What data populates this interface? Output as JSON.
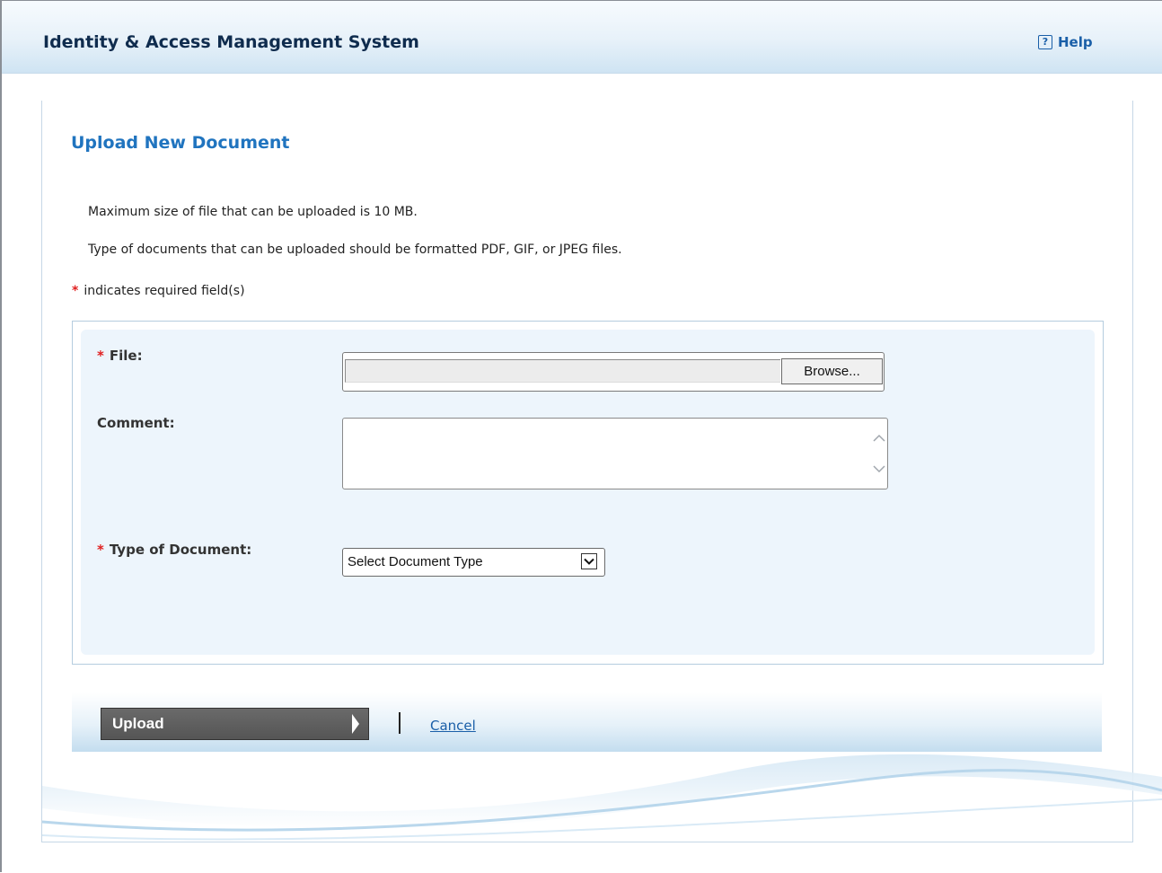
{
  "header": {
    "app_title": "Identity & Access Management System",
    "help_label": "Help",
    "help_icon_glyph": "?"
  },
  "page": {
    "title": "Upload New Document",
    "info_lines": [
      "Maximum size of file that can be uploaded is 10 MB.",
      "Type of documents that can be uploaded should be formatted PDF, GIF, or JPEG files."
    ],
    "required_note": "indicates required field(s)",
    "required_marker": "*"
  },
  "form": {
    "file_label": "File:",
    "file_value": "",
    "browse_label": "Browse...",
    "comment_label": "Comment:",
    "comment_value": "",
    "doc_type_label": "Type of Document:",
    "doc_type_selected": "Select Document Type"
  },
  "actions": {
    "upload_label": "Upload",
    "cancel_label": "Cancel"
  },
  "icons": {
    "help": "help-icon",
    "dropdown": "chevron-down-icon",
    "scroll_up": "chevron-up-icon",
    "scroll_down": "chevron-down-icon",
    "upload_arrow": "arrow-right-icon"
  },
  "colors": {
    "title_blue": "#2074bf",
    "link_blue": "#1a5fa8",
    "required_red": "#e02020",
    "form_bg": "#edf5fc",
    "upload_button": "#5f5f5f"
  }
}
